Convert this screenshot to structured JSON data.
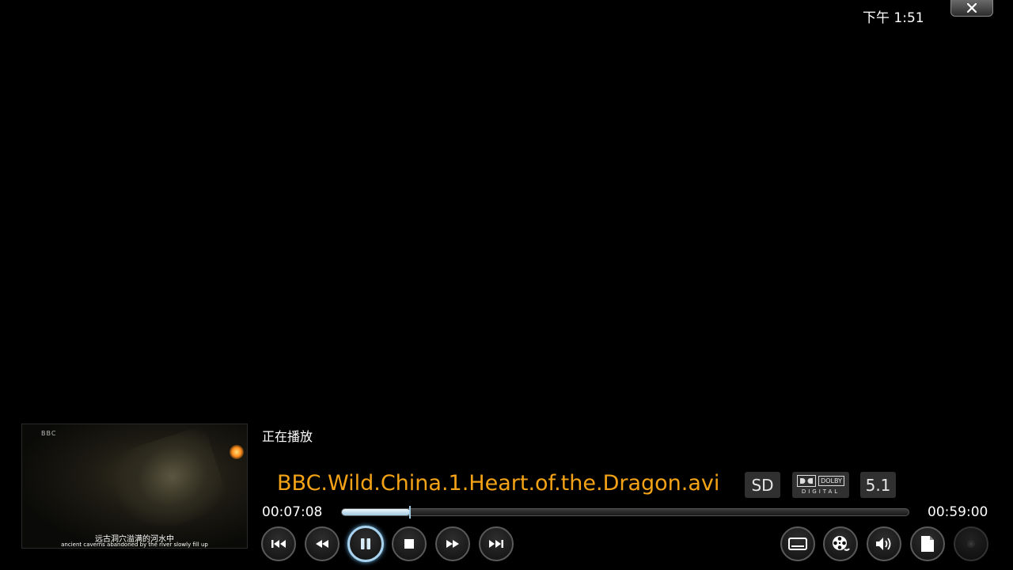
{
  "clock": "下午 1:51",
  "close_icon": "x-icon",
  "player": {
    "status_label": "正在播放",
    "title": "BBC.Wild.China.1.Heart.of.the.Dragon.avi",
    "elapsed": "00:07:08",
    "duration": "00:59:00",
    "progress_fraction": 0.12,
    "badges": {
      "sd": "SD",
      "dolby_top": "DOLBY",
      "dolby_bottom": "DIGITAL",
      "channels": "5.1"
    },
    "accent_color": "#f5a316",
    "progress_color": "#9ec8e0"
  },
  "thumbnail": {
    "logo": "BBC",
    "subtitle_cn": "远古洞穴溢满的河水中",
    "subtitle_en": "ancient caverns abandoned by the river slowly fill up"
  },
  "controls": {
    "left": [
      {
        "icon": "skip-previous-icon"
      },
      {
        "icon": "rewind-icon"
      },
      {
        "icon": "pause-icon"
      },
      {
        "icon": "stop-icon"
      },
      {
        "icon": "fast-forward-icon"
      },
      {
        "icon": "skip-next-icon"
      }
    ],
    "right": [
      {
        "icon": "subtitles-icon"
      },
      {
        "icon": "video-settings-icon"
      },
      {
        "icon": "volume-icon"
      },
      {
        "icon": "bookmark-icon"
      },
      {
        "icon": "record-icon"
      }
    ]
  }
}
